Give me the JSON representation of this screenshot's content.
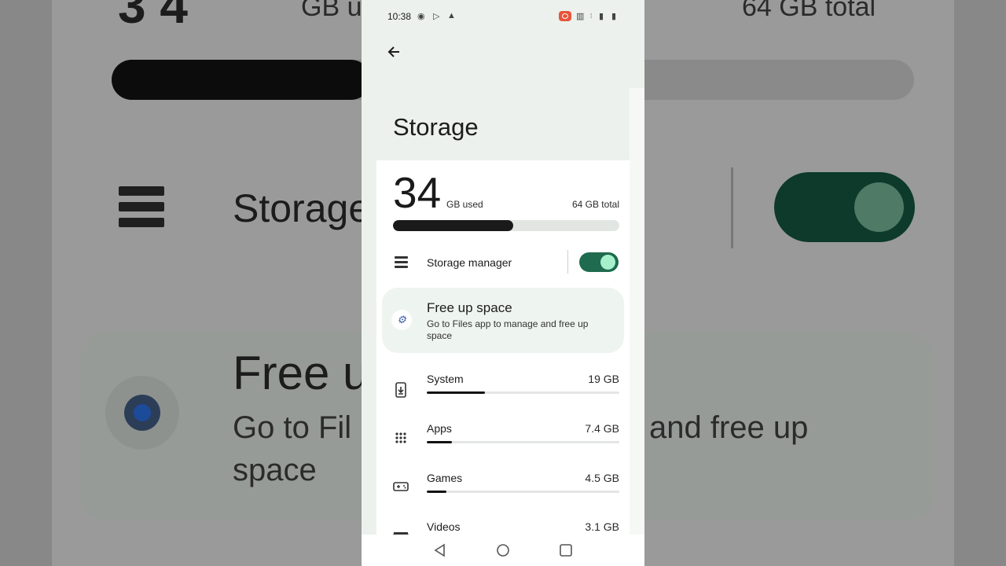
{
  "status_bar": {
    "time": "10:38"
  },
  "page": {
    "title": "Storage"
  },
  "summary": {
    "used_value": "34",
    "used_unit": "GB used",
    "total": "64 GB total",
    "used_fraction": 0.53
  },
  "storage_manager": {
    "label": "Storage manager",
    "enabled": true
  },
  "free_up": {
    "title": "Free up space",
    "description": "Go to Files app to manage and free up space"
  },
  "categories": [
    {
      "name": "System",
      "size": "19 GB",
      "fraction": 0.3,
      "icon": "phone-download-icon"
    },
    {
      "name": "Apps",
      "size": "7.4 GB",
      "fraction": 0.13,
      "icon": "apps-grid-icon"
    },
    {
      "name": "Games",
      "size": "4.5 GB",
      "fraction": 0.1,
      "icon": "gamepad-icon"
    },
    {
      "name": "Videos",
      "size": "3.1 GB",
      "fraction": 0.08,
      "icon": "clapperboard-icon"
    }
  ],
  "background": {
    "used_fragment": "GB u",
    "total": "64 GB total",
    "storage_label": "Storage",
    "free_up_fragment": "Free u",
    "desc_fragment_1": "Go to Fil",
    "desc_fragment_2": "and free up",
    "desc_fragment_3": "space"
  }
}
